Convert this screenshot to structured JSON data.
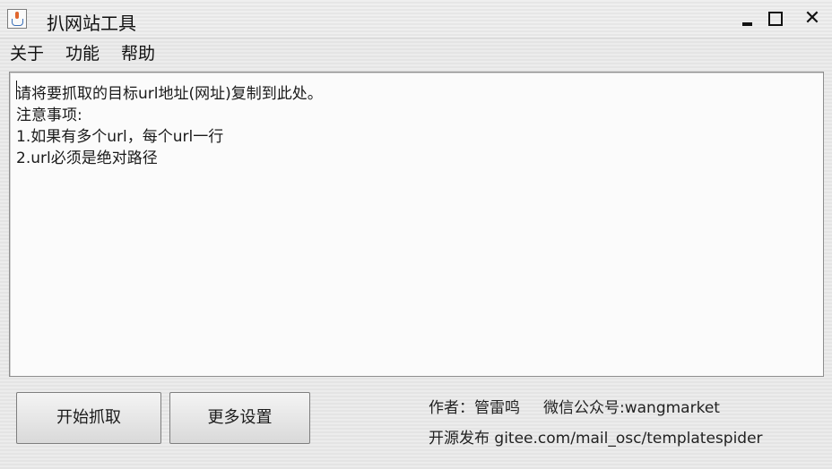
{
  "window": {
    "title": "扒网站工具",
    "controls": {
      "minimize": "minimize",
      "maximize": "maximize",
      "close": "✕"
    }
  },
  "menu": [
    "关于",
    "功能",
    "帮助"
  ],
  "textarea": {
    "lines": [
      "请将要抓取的目标url地址(网址)复制到此处。",
      "注意事项:",
      "1.如果有多个url，每个url一行",
      "2.url必须是绝对路径"
    ]
  },
  "buttons": {
    "start": "开始抓取",
    "settings": "更多设置"
  },
  "info": {
    "author": "作者：管雷鸣",
    "wechat": "微信公众号:wangmarket",
    "source": "开源发布 gitee.com/mail_osc/templatespider"
  },
  "icons": {
    "app": "java-cup-icon",
    "minimize": "minimize-icon",
    "maximize": "maximize-icon",
    "close": "close-icon"
  }
}
